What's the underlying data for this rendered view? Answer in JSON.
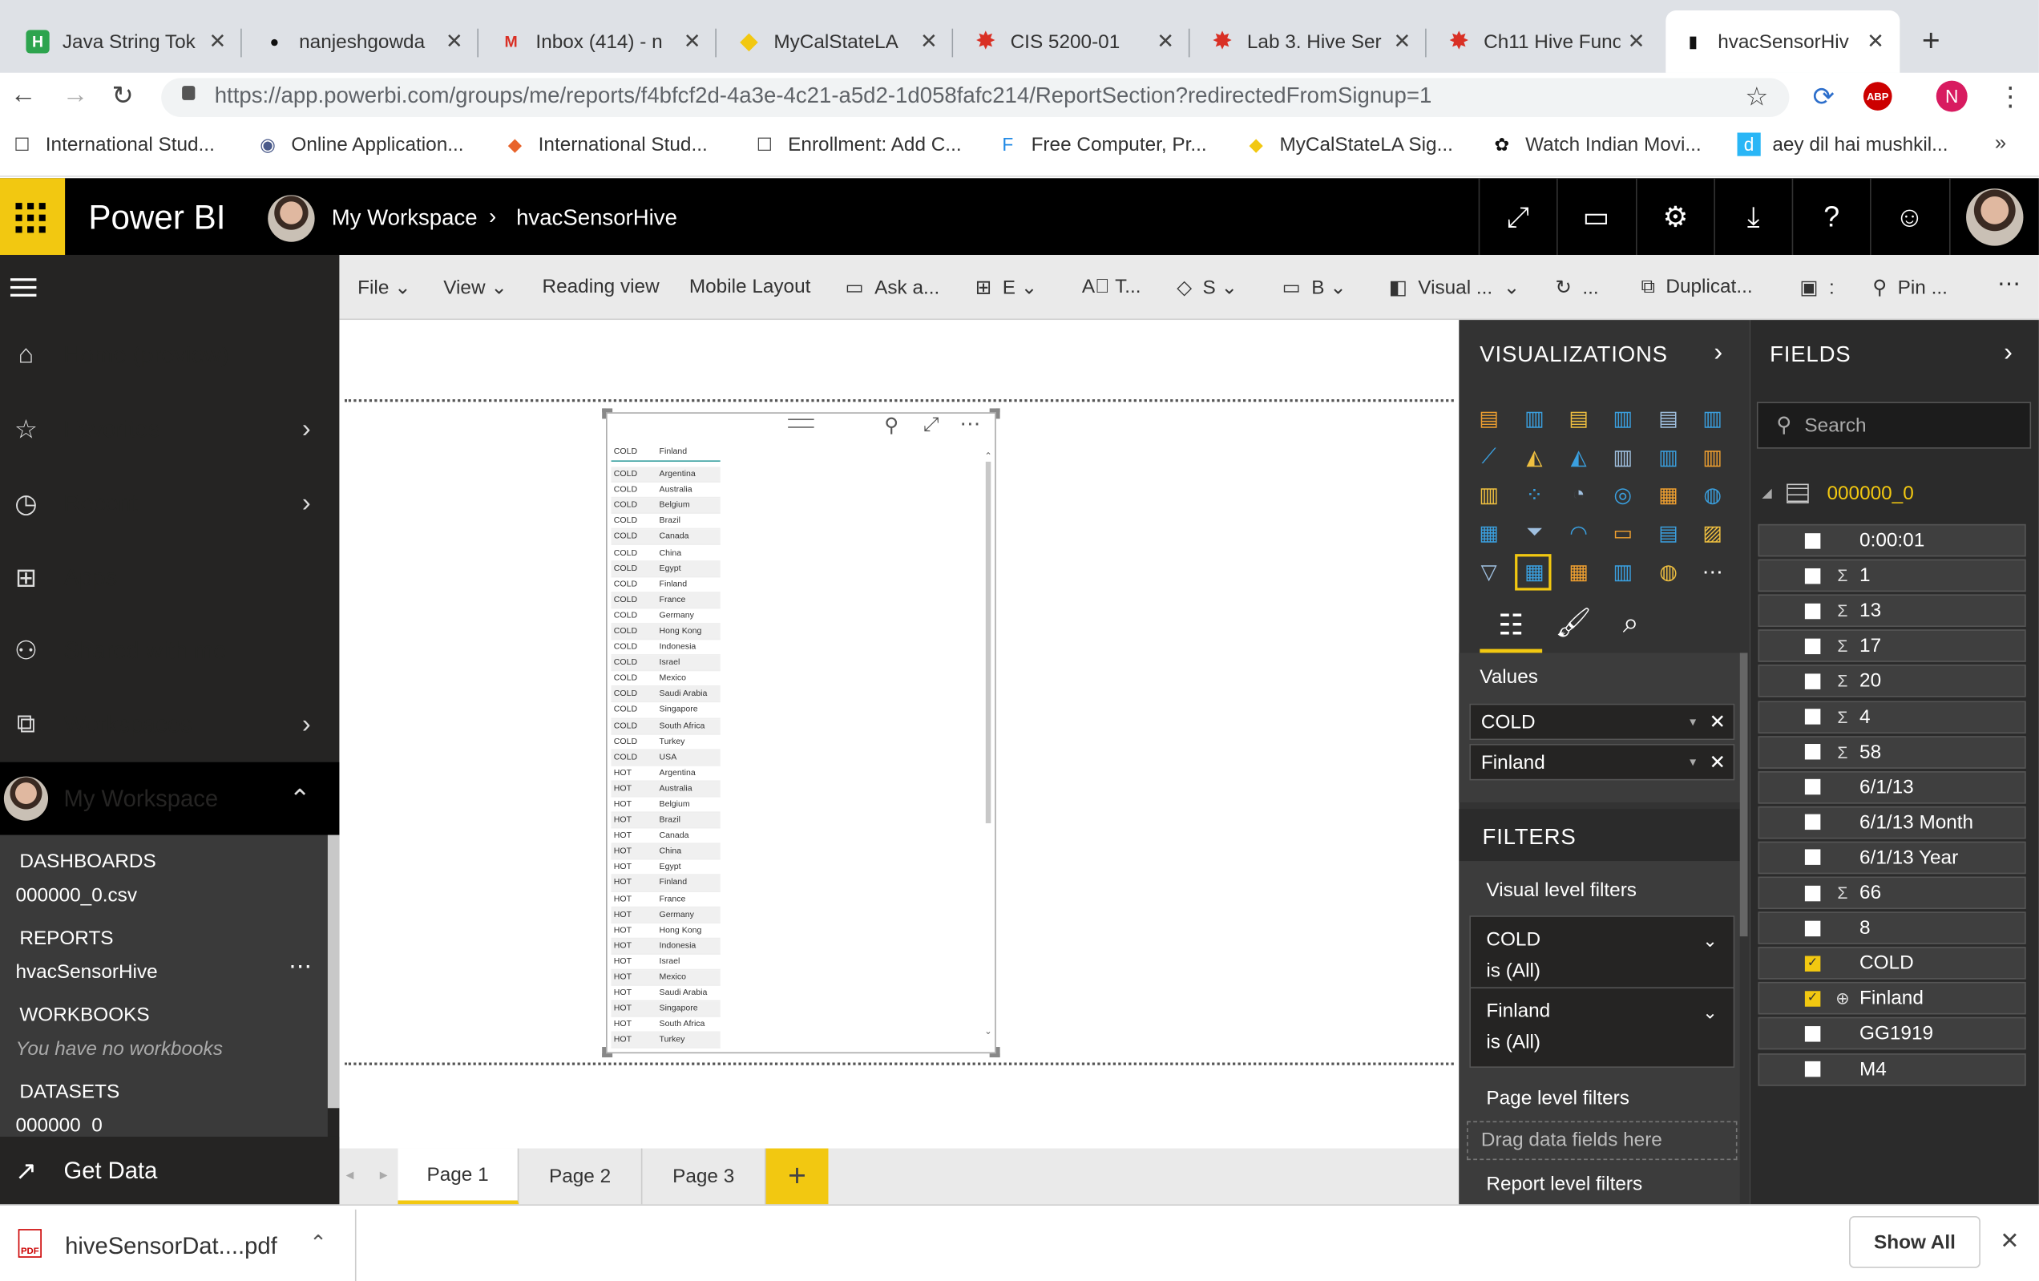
{
  "browser": {
    "tabs": [
      {
        "title": "Java String Tok",
        "icon": "H",
        "color": "#2da44e"
      },
      {
        "title": "nanjeshgowda",
        "icon": "gh",
        "color": "#111"
      },
      {
        "title": "Inbox (414) - n",
        "icon": "M",
        "color": "#d93025"
      },
      {
        "title": "MyCalStateLA",
        "icon": "sh",
        "color": "#f2c811"
      },
      {
        "title": "CIS 5200-01",
        "icon": "cv",
        "color": "#d93025"
      },
      {
        "title": "Lab 3. Hive Ser",
        "icon": "cv",
        "color": "#d93025"
      },
      {
        "title": "Ch11 Hive Func",
        "icon": "cv",
        "color": "#d93025"
      },
      {
        "title": "hvacSensorHiv",
        "icon": "bi",
        "color": "#111"
      }
    ],
    "url_host": "https://app.powerbi.com",
    "url_path": "/groups/me/reports/f4bfcf2d-4a3e-4c21-a5d2-1d058fafc214/ReportSection?redirectedFromSignup=1",
    "profile_initial": "N",
    "bookmarks": [
      "International Stud...",
      "Online Application...",
      "International Stud...",
      "Enrollment: Add C...",
      "Free Computer, Pr...",
      "MyCalStateLA Sig...",
      "Watch Indian Movi...",
      "aey dil hai mushkil..."
    ]
  },
  "app": {
    "name": "Power BI",
    "workspace": "My Workspace",
    "report": "hvacSensorHive"
  },
  "nav": {
    "items": [
      "Home (preview)",
      "Favorites",
      "Recent",
      "Apps",
      "Shared with me",
      "Workspaces",
      "My Workspace"
    ],
    "dashboards_header": "DASHBOARDS",
    "dashboard_item": "000000_0.csv",
    "reports_header": "REPORTS",
    "report_item": "hvacSensorHive",
    "workbooks_header": "WORKBOOKS",
    "workbooks_empty": "You have no workbooks",
    "datasets_header": "DATASETS",
    "dataset_item": "000000_0",
    "get_data": "Get Data"
  },
  "toolbar": {
    "file": "File",
    "view": "View",
    "reading_view": "Reading view",
    "mobile_layout": "Mobile Layout",
    "ask": "Ask a...",
    "explore": "E",
    "textbox": "T...",
    "shapes": "S",
    "buttons": "B",
    "visual": "Visual ...",
    "refresh": "...",
    "duplicate": "Duplicat...",
    "save": ":",
    "pin": "Pin ...",
    "more": "⋯"
  },
  "table_visual": {
    "headers": [
      "COLD",
      "Finland"
    ],
    "rows": [
      [
        "COLD",
        "Argentina"
      ],
      [
        "COLD",
        "Australia"
      ],
      [
        "COLD",
        "Belgium"
      ],
      [
        "COLD",
        "Brazil"
      ],
      [
        "COLD",
        "Canada"
      ],
      [
        "COLD",
        "China"
      ],
      [
        "COLD",
        "Egypt"
      ],
      [
        "COLD",
        "Finland"
      ],
      [
        "COLD",
        "France"
      ],
      [
        "COLD",
        "Germany"
      ],
      [
        "COLD",
        "Hong Kong"
      ],
      [
        "COLD",
        "Indonesia"
      ],
      [
        "COLD",
        "Israel"
      ],
      [
        "COLD",
        "Mexico"
      ],
      [
        "COLD",
        "Saudi Arabia"
      ],
      [
        "COLD",
        "Singapore"
      ],
      [
        "COLD",
        "South Africa"
      ],
      [
        "COLD",
        "Turkey"
      ],
      [
        "COLD",
        "USA"
      ],
      [
        "HOT",
        "Argentina"
      ],
      [
        "HOT",
        "Australia"
      ],
      [
        "HOT",
        "Belgium"
      ],
      [
        "HOT",
        "Brazil"
      ],
      [
        "HOT",
        "Canada"
      ],
      [
        "HOT",
        "China"
      ],
      [
        "HOT",
        "Egypt"
      ],
      [
        "HOT",
        "Finland"
      ],
      [
        "HOT",
        "France"
      ],
      [
        "HOT",
        "Germany"
      ],
      [
        "HOT",
        "Hong Kong"
      ],
      [
        "HOT",
        "Indonesia"
      ],
      [
        "HOT",
        "Israel"
      ],
      [
        "HOT",
        "Mexico"
      ],
      [
        "HOT",
        "Saudi Arabia"
      ],
      [
        "HOT",
        "Singapore"
      ],
      [
        "HOT",
        "South Africa"
      ],
      [
        "HOT",
        "Turkey"
      ]
    ]
  },
  "visualizations": {
    "title": "VISUALIZATIONS",
    "values_label": "Values",
    "wells": [
      "COLD",
      "Finland"
    ]
  },
  "filters": {
    "title": "FILTERS",
    "visual_level": "Visual level filters",
    "items": [
      {
        "field": "COLD",
        "state": "is (All)"
      },
      {
        "field": "Finland",
        "state": "is (All)"
      }
    ],
    "page_level": "Page level filters",
    "drag_hint": "Drag data fields here",
    "report_level": "Report level filters"
  },
  "fields": {
    "title": "FIELDS",
    "search_placeholder": "Search",
    "table_name": "000000_0",
    "items": [
      {
        "name": "0:00:01",
        "sigma": false,
        "checked": false
      },
      {
        "name": "1",
        "sigma": true,
        "checked": false
      },
      {
        "name": "13",
        "sigma": true,
        "checked": false
      },
      {
        "name": "17",
        "sigma": true,
        "checked": false
      },
      {
        "name": "20",
        "sigma": true,
        "checked": false
      },
      {
        "name": "4",
        "sigma": true,
        "checked": false
      },
      {
        "name": "58",
        "sigma": true,
        "checked": false
      },
      {
        "name": "6/1/13",
        "sigma": false,
        "checked": false
      },
      {
        "name": "6/1/13 Month",
        "sigma": false,
        "checked": false
      },
      {
        "name": "6/1/13 Year",
        "sigma": false,
        "checked": false
      },
      {
        "name": "66",
        "sigma": true,
        "checked": false
      },
      {
        "name": "8",
        "sigma": false,
        "checked": false
      },
      {
        "name": "COLD",
        "sigma": false,
        "checked": true
      },
      {
        "name": "Finland",
        "sigma": false,
        "checked": true,
        "globe": true
      },
      {
        "name": "GG1919",
        "sigma": false,
        "checked": false
      },
      {
        "name": "M4",
        "sigma": false,
        "checked": false
      }
    ]
  },
  "pages": [
    "Page 1",
    "Page 2",
    "Page 3"
  ],
  "download": {
    "file": "hiveSensorDat....pdf",
    "show_all": "Show All"
  },
  "colors": {
    "accent": "#f2c811",
    "nav_bg": "#252423",
    "pane_bg": "#333333"
  }
}
